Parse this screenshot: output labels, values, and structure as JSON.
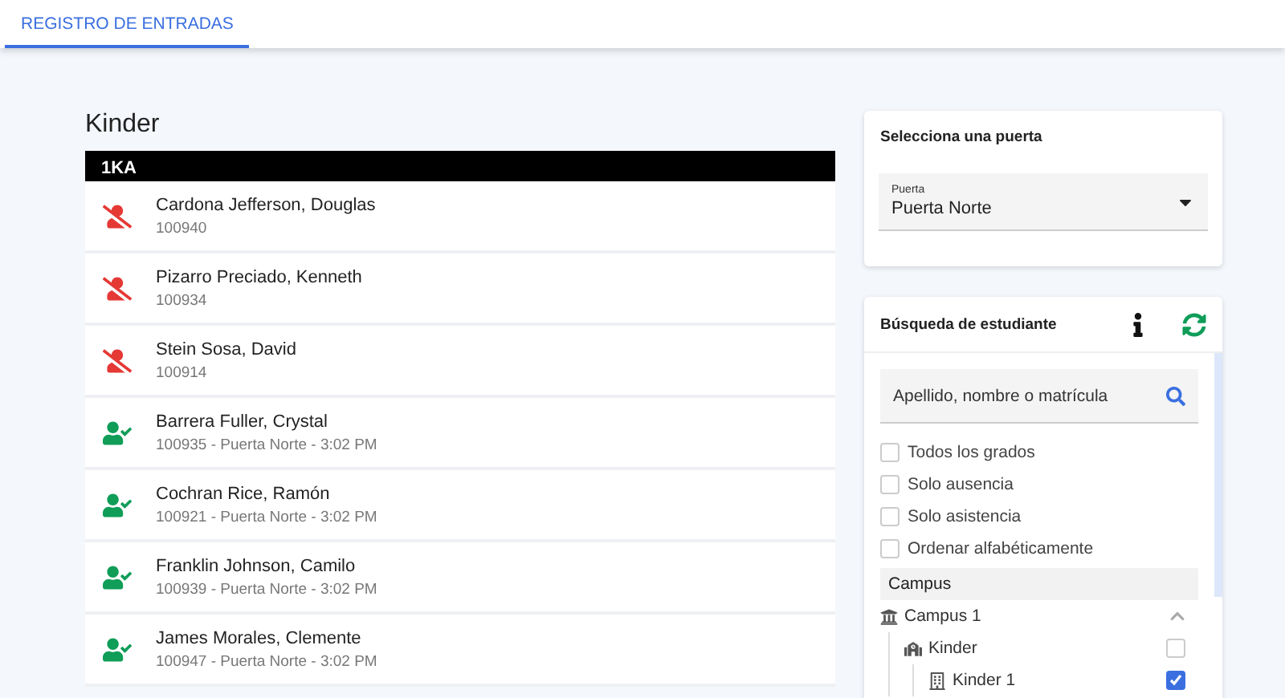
{
  "tabs": [
    {
      "label": "REGISTRO DE ENTRADAS",
      "selected": true
    }
  ],
  "group": {
    "title": "Kinder",
    "section": "1KA"
  },
  "students": [
    {
      "name": "Cardona Jefferson, Douglas",
      "detail": "100940",
      "present": false
    },
    {
      "name": "Pizarro Preciado, Kenneth",
      "detail": "100934",
      "present": false
    },
    {
      "name": "Stein Sosa, David",
      "detail": "100914",
      "present": false
    },
    {
      "name": "Barrera Fuller, Crystal",
      "detail": "100935 - Puerta Norte - 3:02 PM",
      "present": true
    },
    {
      "name": "Cochran Rice, Ramón",
      "detail": "100921 - Puerta Norte - 3:02 PM",
      "present": true
    },
    {
      "name": "Franklin Johnson, Camilo",
      "detail": "100939 - Puerta Norte - 3:02 PM",
      "present": true
    },
    {
      "name": "James Morales, Clemente",
      "detail": "100947 - Puerta Norte - 3:02 PM",
      "present": true
    }
  ],
  "gate_card": {
    "title": "Selecciona una puerta",
    "label": "Puerta",
    "value": "Puerta Norte"
  },
  "search_card": {
    "title": "Búsqueda de estudiante",
    "placeholder": "Apellido, nombre o matrícula",
    "filters": [
      {
        "label": "Todos los grados",
        "checked": false
      },
      {
        "label": "Solo ausencia",
        "checked": false
      },
      {
        "label": "Solo asistencia",
        "checked": false
      },
      {
        "label": "Ordenar alfabéticamente",
        "checked": false
      }
    ],
    "tree_title": "Campus",
    "tree": [
      {
        "label": "Campus 1",
        "kind": "campus",
        "expanded": true,
        "children": [
          {
            "label": "Kinder",
            "kind": "school",
            "checked": false,
            "children": [
              {
                "label": "Kinder 1",
                "kind": "classroom",
                "checked": true
              }
            ]
          }
        ]
      }
    ]
  }
}
